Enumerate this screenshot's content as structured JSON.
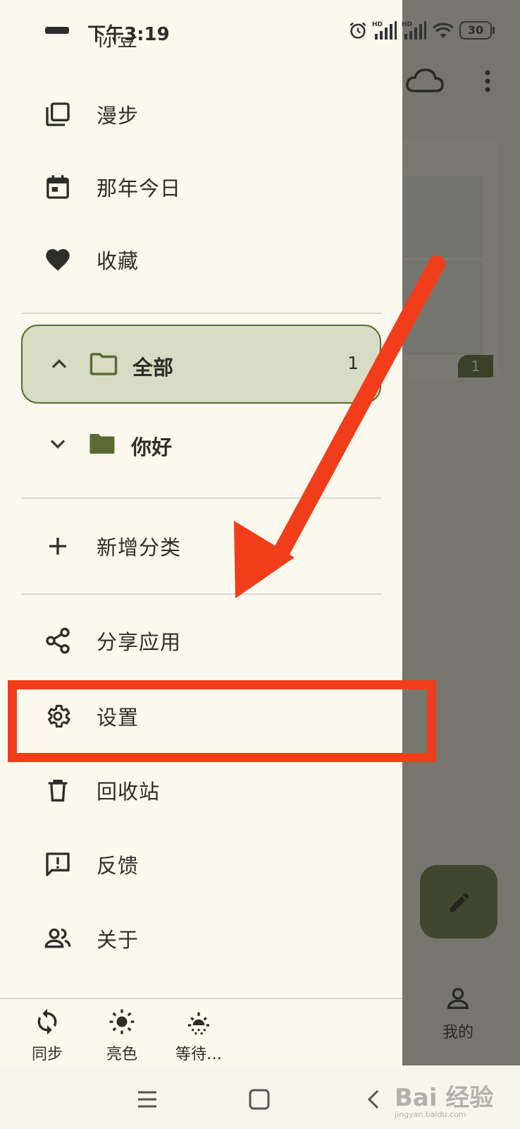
{
  "status_bar": {
    "time": "下午3:19",
    "battery": "30"
  },
  "drawer": {
    "partial_top_item": "你登",
    "items_top": [
      {
        "label": "漫步",
        "icon": "library-icon"
      },
      {
        "label": "那年今日",
        "icon": "calendar-icon"
      },
      {
        "label": "收藏",
        "icon": "heart-icon"
      }
    ],
    "folders": [
      {
        "label": "全部",
        "count": "1",
        "expanded": true,
        "selected": true
      },
      {
        "label": "你好",
        "count": "",
        "expanded": false,
        "selected": false
      }
    ],
    "add_category": "新增分类",
    "items_bottom": [
      {
        "label": "分享应用",
        "icon": "share-icon"
      },
      {
        "label": "设置",
        "icon": "gear-icon"
      },
      {
        "label": "回收站",
        "icon": "trash-icon"
      },
      {
        "label": "反馈",
        "icon": "feedback-icon"
      },
      {
        "label": "关于",
        "icon": "people-icon"
      }
    ],
    "toolbar": [
      {
        "label": "同步",
        "icon": "sync-icon"
      },
      {
        "label": "亮色",
        "icon": "sun-icon"
      },
      {
        "label": "等待…",
        "icon": "sunrise-icon"
      }
    ]
  },
  "background": {
    "note_count": "1",
    "mine_label": "我的"
  },
  "watermark": {
    "text": "Bai 经验",
    "sub": "jingyan.baidu.com"
  },
  "colors": {
    "accent": "#596b33",
    "annotation": "#f23d1a",
    "drawer_bg": "#fbf9ee"
  }
}
